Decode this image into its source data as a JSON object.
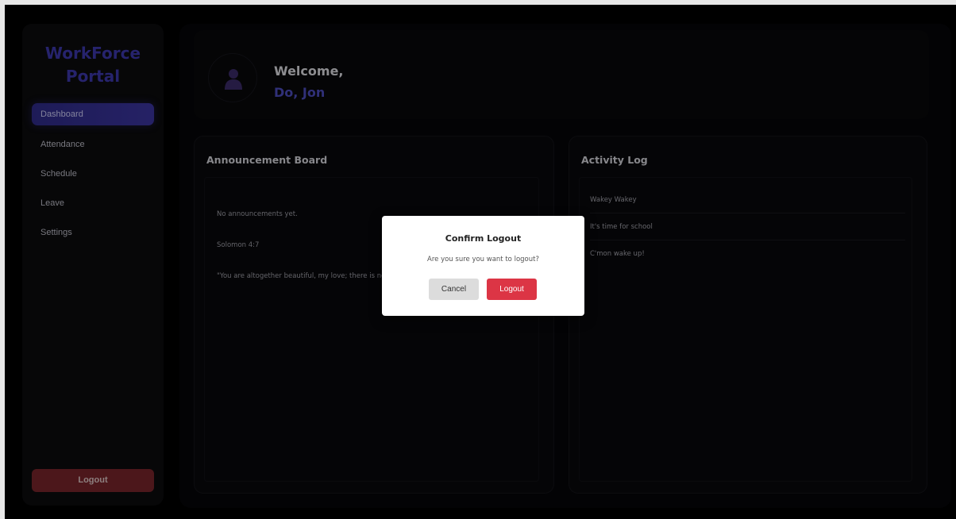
{
  "sidebar": {
    "brand_line1": "WorkForce",
    "brand_line2": "Portal",
    "nav": [
      {
        "label": "Dashboard",
        "active": true
      },
      {
        "label": "Attendance",
        "active": false
      },
      {
        "label": "Schedule",
        "active": false
      },
      {
        "label": "Leave",
        "active": false
      },
      {
        "label": "Settings",
        "active": false
      }
    ],
    "logout_label": "Logout"
  },
  "header": {
    "welcome": "Welcome,",
    "name": "Do, Jon",
    "avatar_icon": "user-icon"
  },
  "announcements": {
    "title": "Announcement Board",
    "lines": [
      "No announcements yet.",
      "Solomon 4:7",
      "\"You are altogether beautiful, my love; there is no flaw in you."
    ]
  },
  "activity_log": {
    "title": "Activity Log",
    "items": [
      "Wakey Wakey",
      "It's time for school",
      "C'mon wake up!"
    ]
  },
  "modal": {
    "title": "Confirm Logout",
    "message": "Are you sure you want to logout?",
    "cancel_label": "Cancel",
    "confirm_label": "Logout"
  },
  "colors": {
    "accent": "#3b37a8",
    "danger": "#dc3545",
    "background": "#000000"
  }
}
